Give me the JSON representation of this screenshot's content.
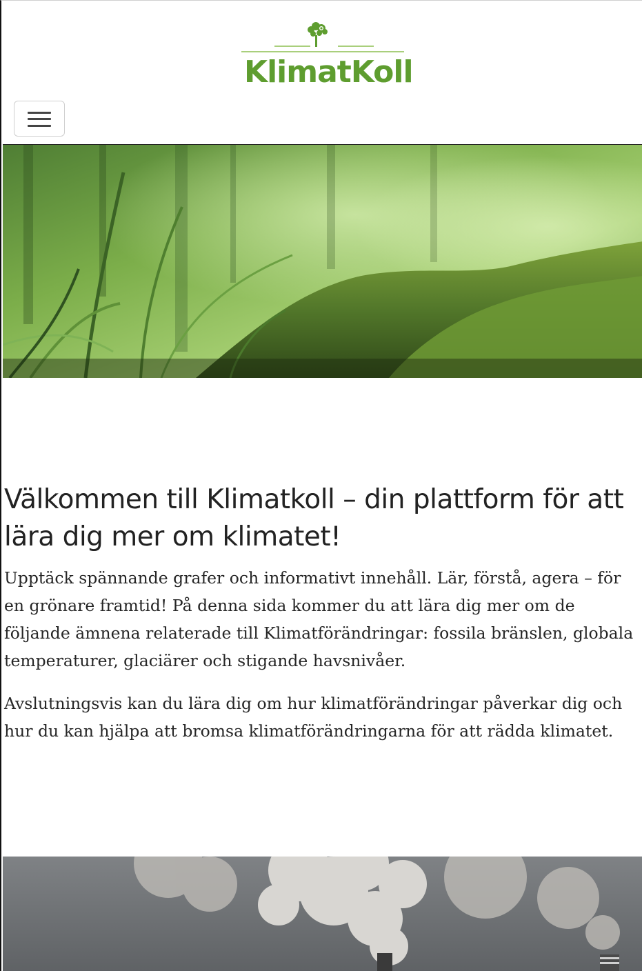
{
  "header": {
    "logo_text": "KlimatKoll",
    "brand_color": "#5e9d2f",
    "logo_icon": "tree-icon"
  },
  "nav": {
    "toggle_icon": "hamburger-menu-icon"
  },
  "hero": {
    "image": "moss-and-grass-photo"
  },
  "main": {
    "heading": "Välkommen till Klimatkoll – din plattform för att lära dig mer om klimatet!",
    "paragraph_1": "Upptäck spännande grafer och informativt innehåll. Lär, förstå, agera – för en grönare framtid! På denna sida kommer du att lära dig mer om de följande ämnena relaterade till Klimatförändringar: fossila bränslen, globala temperaturer, glaciärer och stigande havsnivåer.",
    "paragraph_2": "Avslutningsvis kan du lära dig om hur klimatförändringar påverkar dig och hur du kan hjälpa att bromsa klimatförändringarna för att rädda klimatet."
  },
  "bottom": {
    "image": "factory-smoke-photo"
  }
}
